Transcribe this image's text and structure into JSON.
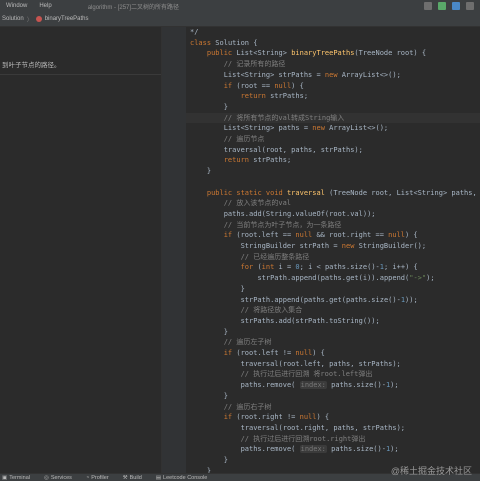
{
  "titlebar": {
    "menus": [
      "Window",
      "Help"
    ],
    "title": "algorithm - [257]二叉树的所有路径"
  },
  "navbar": {
    "crumb1": "Solution",
    "sep": "〉",
    "crumb2": "binaryTreePaths"
  },
  "left_panel": {
    "description": "到叶子节点的路径。"
  },
  "editor": {
    "lines": [
      {
        "n": "49",
        "t": "*/"
      },
      {
        "n": "50",
        "t": "class Solution {"
      },
      {
        "n": "51",
        "t": "    public List<String> binaryTreePaths(TreeNode root) {"
      },
      {
        "n": "52",
        "t": "        // 记录所有的路径"
      },
      {
        "n": "53",
        "t": "        List<String> strPaths = new ArrayList<>();"
      },
      {
        "n": "54",
        "t": "        if (root == null) {"
      },
      {
        "n": "55",
        "t": "            return strPaths;"
      },
      {
        "n": "56",
        "t": "        }"
      },
      {
        "n": "57",
        "t": "        // 将所有节点的val转成String输入"
      },
      {
        "n": "58",
        "t": "        List<String> paths = new ArrayList<>();"
      },
      {
        "n": "59",
        "t": "        // 遍历节点"
      },
      {
        "n": "60",
        "t": "        traversal(root, paths, strPaths);"
      },
      {
        "n": "61",
        "t": "        return strPaths;"
      },
      {
        "n": "62",
        "t": "    }"
      },
      {
        "n": "63",
        "t": ""
      },
      {
        "n": "64",
        "t": "    public static void traversal (TreeNode root, List<String> paths, List<Str"
      },
      {
        "n": "65",
        "t": "        // 放入该节点的val"
      },
      {
        "n": "66",
        "t": "        paths.add(String.valueOf(root.val));"
      },
      {
        "n": "67",
        "t": "        // 当前节点为叶子节点，为一条路径"
      },
      {
        "n": "68",
        "t": "        if (root.left == null && root.right == null) {"
      },
      {
        "n": "69",
        "t": "            StringBuilder strPath = new StringBuilder();"
      },
      {
        "n": "70",
        "t": "            // 已经遍历整条路径"
      },
      {
        "n": "71",
        "t": "            for (int i = 0; i < paths.size()-1; i++) {"
      },
      {
        "n": "72",
        "t": "                strPath.append(paths.get(i)).append(\"->\");"
      },
      {
        "n": "73",
        "t": "            }"
      },
      {
        "n": "74",
        "t": "            strPath.append(paths.get(paths.size()-1));"
      },
      {
        "n": "75",
        "t": "            // 将路径放入集合"
      },
      {
        "n": "76",
        "t": "            strPaths.add(strPath.toString());"
      },
      {
        "n": "77",
        "t": "        }"
      },
      {
        "n": "78",
        "t": "        // 遍历左子树"
      },
      {
        "n": "79",
        "t": "        if (root.left != null) {"
      },
      {
        "n": "80",
        "t": "            traversal(root.left, paths, strPaths);"
      },
      {
        "n": "81",
        "t": "            // 执行过后进行回溯 将root.left弹出"
      },
      {
        "n": "82",
        "t": "            paths.remove( index: paths.size()-1);"
      },
      {
        "n": "83",
        "t": "        }"
      },
      {
        "n": "84",
        "t": "        // 遍历右子树"
      },
      {
        "n": "85",
        "t": "        if (root.right != null) {"
      },
      {
        "n": "86",
        "t": "            traversal(root.right, paths, strPaths);"
      },
      {
        "n": "87",
        "t": "            // 执行过后进行回溯root.right弹出"
      },
      {
        "n": "88",
        "t": "            paths.remove( index: paths.size()-1);"
      },
      {
        "n": "89",
        "t": "        }"
      },
      {
        "n": "90",
        "t": "    }"
      },
      {
        "n": "91",
        "t": "}"
      }
    ]
  },
  "statusbar": {
    "items": [
      "Terminal",
      "Services",
      "Profiler",
      "Build",
      "Leetcode Console"
    ]
  },
  "watermark": "@稀土掘金技术社区",
  "colors": {
    "keyword": "#cc7832",
    "string": "#6a8759",
    "comment": "#808080",
    "method": "#ffc66d",
    "number": "#6897bb",
    "default": "#a9b7c6",
    "background": "#2b2b2b"
  }
}
